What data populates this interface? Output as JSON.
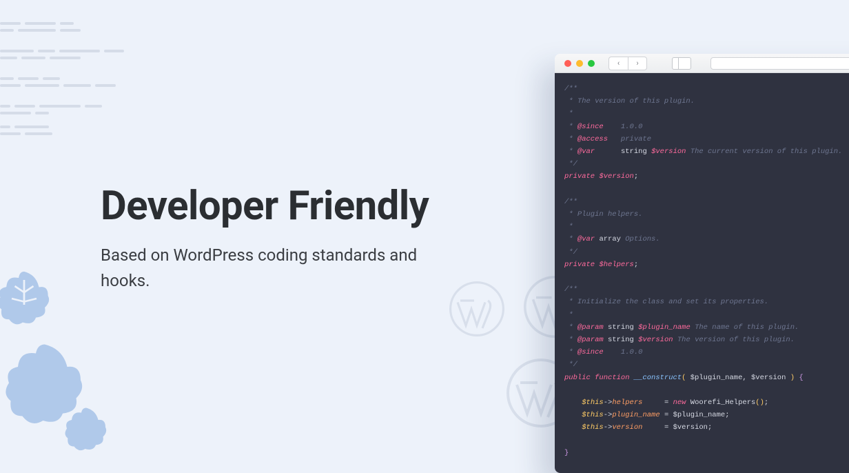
{
  "heading": "Developer Friendly",
  "subheading": "Based on WordPress coding standards and hooks.",
  "code": {
    "l1": "/**",
    "l2": " * The version of this plugin.",
    "l3": " *",
    "l4a": " * ",
    "l4b": "@since",
    "l4c": "    1.0.0",
    "l5a": " * ",
    "l5b": "@access",
    "l5c": "   private",
    "l6a": " * ",
    "l6b": "@var",
    "l6c": "      ",
    "l6d": "string",
    "l6e": " ",
    "l6f": "$version",
    "l6g": " The current version of this plugin.",
    "l7": " */",
    "l8a": "private ",
    "l8b": "$version",
    "l8c": ";",
    "l10": "/**",
    "l11": " * Plugin helpers.",
    "l12": " *",
    "l13a": " * ",
    "l13b": "@var",
    "l13c": " ",
    "l13d": "array",
    "l13e": " Options.",
    "l14": " */",
    "l15a": "private ",
    "l15b": "$helpers",
    "l15c": ";",
    "l17": "/**",
    "l18": " * Initialize the class and set its properties.",
    "l19": " *",
    "l20a": " * ",
    "l20b": "@param",
    "l20c": " ",
    "l20d": "string",
    "l20e": " ",
    "l20f": "$plugin_name",
    "l20g": " The name of this plugin.",
    "l21a": " * ",
    "l21b": "@param",
    "l21c": " ",
    "l21d": "string",
    "l21e": " ",
    "l21f": "$version",
    "l21g": " The version of this plugin.",
    "l22a": " * ",
    "l22b": "@since",
    "l22c": "    1.0.0",
    "l23": " */",
    "l24a": "public ",
    "l24b": "function ",
    "l24c": "__construct",
    "l24d": "(",
    "l24e": " $plugin_name",
    "l24f": ",",
    "l24g": " $version ",
    "l24h": ")",
    "l24i": " {",
    "l26a": "    ",
    "l26b": "$this",
    "l26c": "->",
    "l26d": "helpers",
    "l26e": "     = ",
    "l26f": "new",
    "l26g": " ",
    "l26h": "Woorefi_Helpers",
    "l26i": "()",
    "l26j": ";",
    "l27a": "    ",
    "l27b": "$this",
    "l27c": "->",
    "l27d": "plugin_name",
    "l27e": " = ",
    "l27f": "$plugin_name",
    "l27g": ";",
    "l28a": "    ",
    "l28b": "$this",
    "l28c": "->",
    "l28d": "version",
    "l28e": "     = ",
    "l28f": "$version",
    "l28g": ";",
    "l30": "}"
  }
}
